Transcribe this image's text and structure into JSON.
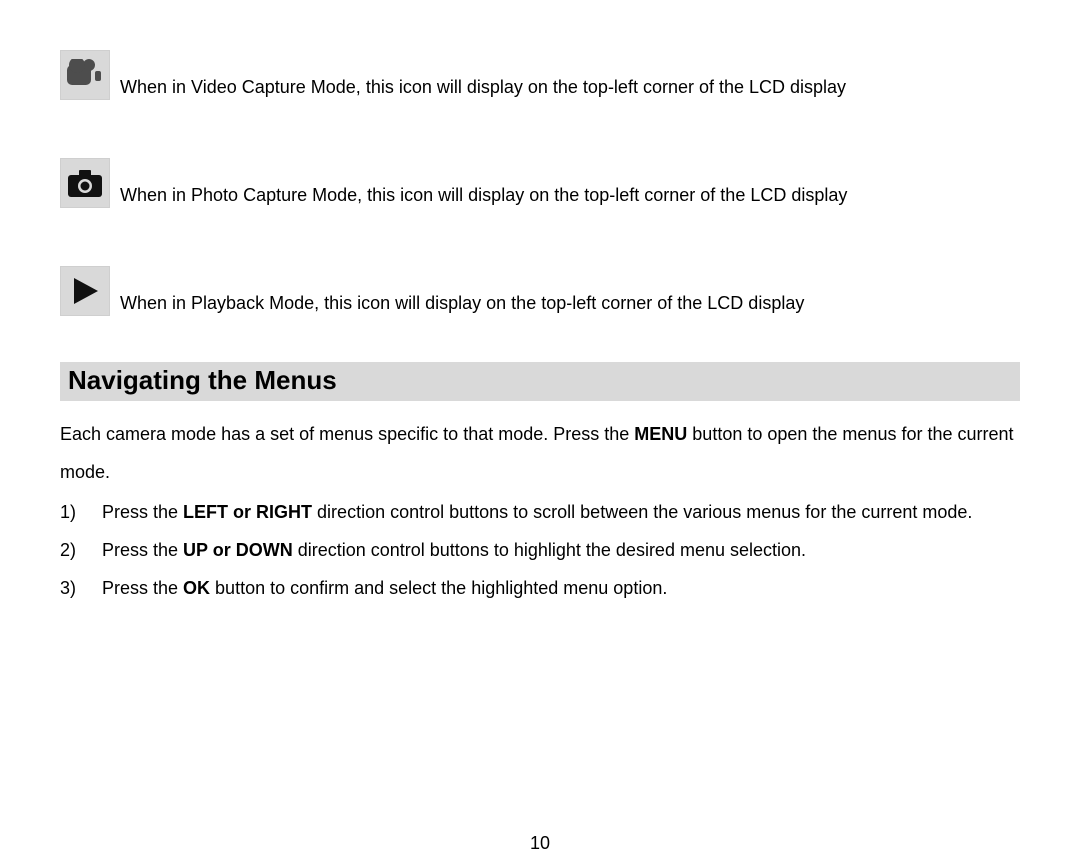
{
  "icons": [
    {
      "name": "video-capture-icon",
      "text": "When in Video Capture Mode, this icon will display on the top-left corner of the LCD display"
    },
    {
      "name": "photo-capture-icon",
      "text": "When in Photo Capture Mode, this icon will display on the top-left corner of the LCD display"
    },
    {
      "name": "playback-icon",
      "text": "When in Playback Mode, this icon will display on the top-left corner of the LCD display"
    }
  ],
  "heading": "Navigating the Menus",
  "intro": {
    "pre": "Each camera mode has a set of menus specific to that mode. Press the ",
    "bold": "MENU",
    "post": " button to open the menus for the current mode."
  },
  "steps": [
    {
      "num": "1)",
      "pre": "Press the ",
      "bold": "LEFT or RIGHT",
      "post": " direction control buttons to scroll between the various menus for the current mode."
    },
    {
      "num": "2)",
      "pre": "Press the ",
      "bold": "UP or DOWN",
      "post": " direction control buttons to highlight the desired menu selection."
    },
    {
      "num": "3)",
      "pre": "Press the ",
      "bold": "OK",
      "post": " button to confirm and select the highlighted menu option."
    }
  ],
  "page_number": "10"
}
